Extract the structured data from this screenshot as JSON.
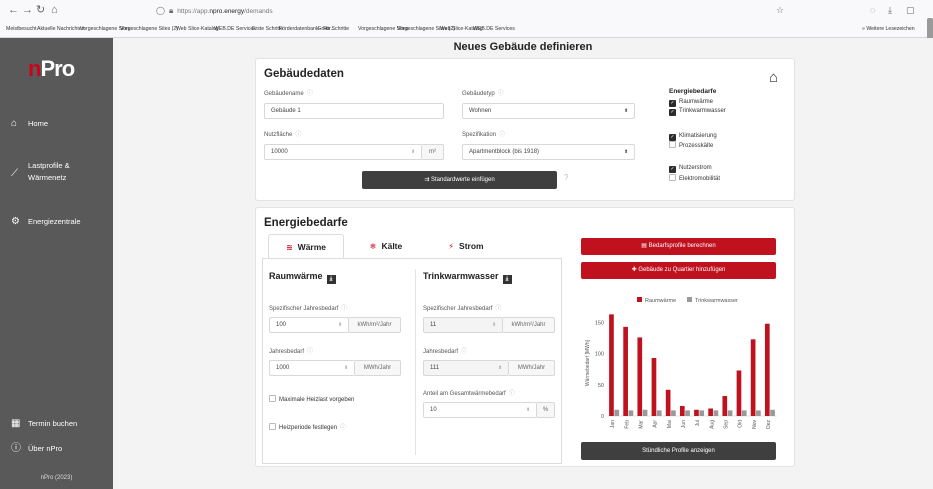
{
  "browser": {
    "url_prefix": "https://app.",
    "url_domain": "npro.energy",
    "url_path": "/demands",
    "bookmarks": [
      "Meistbesucht",
      "Aktuelle Nachrichten",
      "Vorgeschlagene Sites",
      "Vorgeschlagene Sites (2)",
      "Web Slice-Katalog",
      "WEB.DE Services",
      "Erste Schritte",
      "Förderdatenbank - För...",
      "Erste Schritte",
      "Vorgeschlagene Sites",
      "Vorgeschlagene Sites (2)",
      "Web Slice-Katalog",
      "WEB.DE Services"
    ],
    "bookmarks_more": "Weitere Lesezeichen"
  },
  "sidebar": {
    "logo_n": "n",
    "logo_rest": "Pro",
    "items": [
      {
        "label": "Home",
        "icon": "home-icon"
      },
      {
        "label_line1": "Lastprofile &",
        "label_line2": "Wärmenetz",
        "icon": "chart-line-icon"
      },
      {
        "label": "Energiezentrale",
        "icon": "gear-icon"
      },
      {
        "label": "Termin buchen",
        "icon": "calendar-icon"
      },
      {
        "label": "Über nPro",
        "icon": "info-icon"
      }
    ],
    "footer": "nPro (2023)"
  },
  "page": {
    "title": "Neues Gebäude definieren"
  },
  "building": {
    "heading": "Gebäudedaten",
    "name_label": "Gebäudename",
    "name_value": "Gebäude 1",
    "type_label": "Gebäudetyp",
    "type_value": "Wohnen",
    "area_label": "Nutzfläche",
    "area_value": "10000",
    "area_unit": "m²",
    "spec_label": "Spezifikation",
    "spec_value": "Apartmentblock (bis 1918)",
    "defaults_button": "Standardwerte einfügen"
  },
  "needs": {
    "title": "Energiebedarfe",
    "items": [
      {
        "label": "Raumwärme",
        "checked": true
      },
      {
        "label": "Trinkwarmwasser",
        "checked": true
      },
      {
        "label": "Klimatisierung",
        "checked": true
      },
      {
        "label": "Prozesskälte",
        "checked": false
      },
      {
        "label": "Nutzerstrom",
        "checked": true
      },
      {
        "label": "Elektromobilität",
        "checked": false
      }
    ]
  },
  "energy": {
    "heading": "Energiebedarfe",
    "tabs": [
      {
        "label": "Wärme",
        "icon": "heat-icon",
        "active": true
      },
      {
        "label": "Kälte",
        "icon": "snowflake-icon",
        "active": false
      },
      {
        "label": "Strom",
        "icon": "bolt-icon",
        "active": false
      }
    ],
    "room": {
      "title": "Raumwärme",
      "spec_label": "Spezifischer Jahresbedarf",
      "spec_value": "100",
      "spec_unit": "kWh/m²/Jahr",
      "annual_label": "Jahresbedarf",
      "annual_value": "1000",
      "annual_unit": "MWh/Jahr",
      "max_heat_label": "Maximale Heizlast vorgeben",
      "heating_period_label": "Heizperiode festlegen"
    },
    "dhw": {
      "title": "Trinkwarmwasser",
      "spec_label": "Spezifischer Jahresbedarf",
      "spec_value": "11",
      "spec_unit": "kWh/m²/Jahr",
      "annual_label": "Jahresbedarf",
      "annual_value": "111",
      "annual_unit": "MWh/Jahr",
      "share_label": "Anteil am Gesamtwärmebedarf",
      "share_value": "10",
      "share_unit": "%"
    },
    "calc_button": "Bedarfsprofile berechnen",
    "add_button": "Gebäude zu Quartier hinzufügen",
    "hourly_button": "Stündliche Profile anzeigen"
  },
  "colors": {
    "accent": "#c0111f",
    "sidebar": "#595959",
    "series2": "#999999"
  },
  "chart_data": {
    "type": "bar",
    "categories": [
      "Jan",
      "Feb",
      "Mar",
      "Apr",
      "Mai",
      "Jun",
      "Jul",
      "Aug",
      "Sep",
      "Okt",
      "Nov",
      "Dez"
    ],
    "series": [
      {
        "name": "Raumwärme",
        "color": "#c0111f",
        "values": [
          163,
          143,
          126,
          93,
          42,
          16,
          10,
          12,
          32,
          73,
          123,
          148
        ]
      },
      {
        "name": "Trinkwarmwasser",
        "color": "#999999",
        "values": [
          10,
          9,
          10,
          9,
          9,
          9,
          9,
          9,
          9,
          9,
          9,
          10
        ]
      }
    ],
    "ylabel": "Wärmebedarf [MWh]",
    "yticks": [
      0,
      50,
      100,
      150
    ],
    "ylim": [
      0,
      170
    ],
    "legend": "top"
  }
}
